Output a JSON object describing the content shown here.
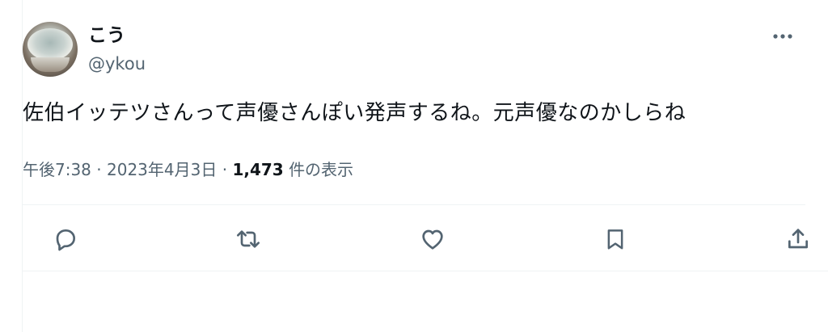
{
  "author": {
    "display_name": "こう",
    "handle": "@ykou",
    "avatar_icon": "teacup-avatar"
  },
  "tweet": {
    "text": "佐伯イッテツさんって声優さんぽい発声するね。元声優なのかしらね"
  },
  "meta": {
    "time": "午後7:38",
    "separator": "·",
    "date": "2023年4月3日",
    "views_count": "1,473",
    "views_label": "件の表示"
  },
  "actions": [
    {
      "icon": "reply-icon"
    },
    {
      "icon": "retweet-icon"
    },
    {
      "icon": "like-icon"
    },
    {
      "icon": "bookmark-icon"
    },
    {
      "icon": "share-icon"
    }
  ],
  "colors": {
    "text_primary": "#0f1419",
    "text_secondary": "#536471",
    "border": "#eff3f4"
  }
}
